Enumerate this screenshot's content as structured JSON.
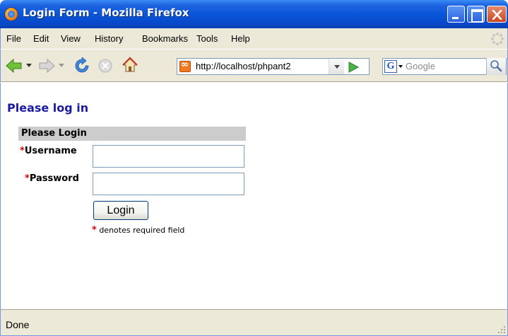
{
  "window": {
    "title": "Login Form - Mozilla Firefox",
    "minimize_icon": "minimize-icon",
    "maximize_icon": "maximize-icon",
    "close_icon": "close-icon"
  },
  "menu": {
    "items": [
      "File",
      "Edit",
      "View",
      "History",
      "Bookmarks",
      "Tools",
      "Help"
    ]
  },
  "toolbar": {
    "back_icon": "back-arrow-icon",
    "forward_icon": "forward-arrow-icon",
    "reload_icon": "reload-icon",
    "stop_icon": "stop-icon",
    "home_icon": "home-icon",
    "url": "http://localhost/phpant2",
    "go_icon": "go-arrow-icon",
    "search_engine_letter": "G",
    "search_placeholder": "Google",
    "search_icon": "magnifier-icon"
  },
  "page": {
    "heading": "Please log in",
    "form_header": "Please Login",
    "required_marker": "*",
    "username_label": "Username",
    "password_label": "Password",
    "username_value": "",
    "password_value": "",
    "login_button": "Login",
    "required_note": "denotes required field"
  },
  "status": {
    "text": "Done"
  },
  "colors": {
    "heading": "#1a1aa3",
    "required": "#e00000",
    "form_header_bg": "#cccccc",
    "chrome_bg": "#ece9d8",
    "titlebar": "#0a56d8"
  }
}
